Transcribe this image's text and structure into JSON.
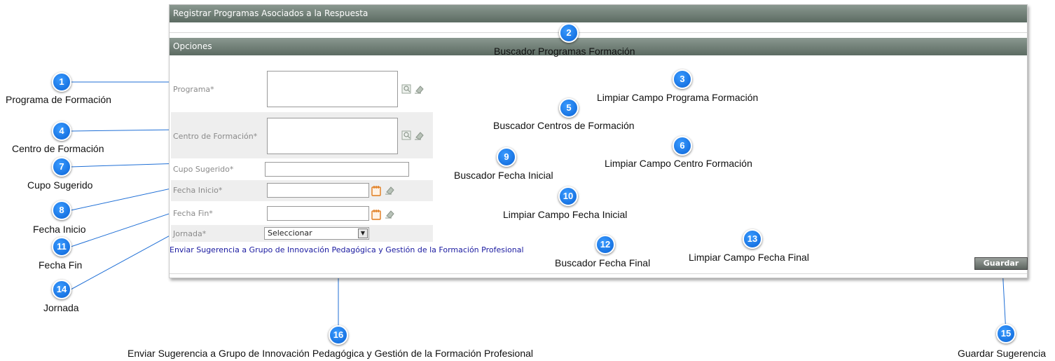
{
  "panel": {
    "title": "Registrar Programas Asociados a la Respuesta",
    "section": "Opciones",
    "fields": {
      "programa": "Programa*",
      "centro": "Centro de Formación*",
      "cupo": "Cupo Sugerido*",
      "fecha_inicio": "Fecha Inicio*",
      "fecha_fin": "Fecha Fin*",
      "jornada": "Jornada*"
    },
    "jornada_selected": "Seleccionar",
    "link": "Enviar Sugerencia a Grupo de Innovación Pedagógica y Gestión de la Formación Profesional",
    "save_button": "Guardar"
  },
  "annotations": [
    {
      "n": "1",
      "text": "Programa de Formación"
    },
    {
      "n": "2",
      "text": "Buscador Programas Formación"
    },
    {
      "n": "3",
      "text": "Limpiar Campo Programa Formación"
    },
    {
      "n": "4",
      "text": "Centro  de Formación"
    },
    {
      "n": "5",
      "text": "Buscador Centros de Formación"
    },
    {
      "n": "6",
      "text": "Limpiar Campo Centro Formación"
    },
    {
      "n": "7",
      "text": "Cupo Sugerido"
    },
    {
      "n": "8",
      "text": "Fecha Inicio"
    },
    {
      "n": "9",
      "text": "Buscador Fecha Inicial"
    },
    {
      "n": "10",
      "text": "Limpiar Campo Fecha Inicial"
    },
    {
      "n": "11",
      "text": "Fecha Fin"
    },
    {
      "n": "12",
      "text": "Buscador Fecha Final"
    },
    {
      "n": "13",
      "text": "Limpiar Campo Fecha Final"
    },
    {
      "n": "14",
      "text": "Jornada"
    },
    {
      "n": "15",
      "text": "Guardar Sugerencia"
    },
    {
      "n": "16",
      "text": "Enviar Sugerencia a Grupo de Innovación Pedagógica y Gestión de la Formación Profesional"
    }
  ],
  "colors": {
    "header": "#6b7a70",
    "badge": "#0a63d6",
    "link": "#1a1aa0"
  }
}
